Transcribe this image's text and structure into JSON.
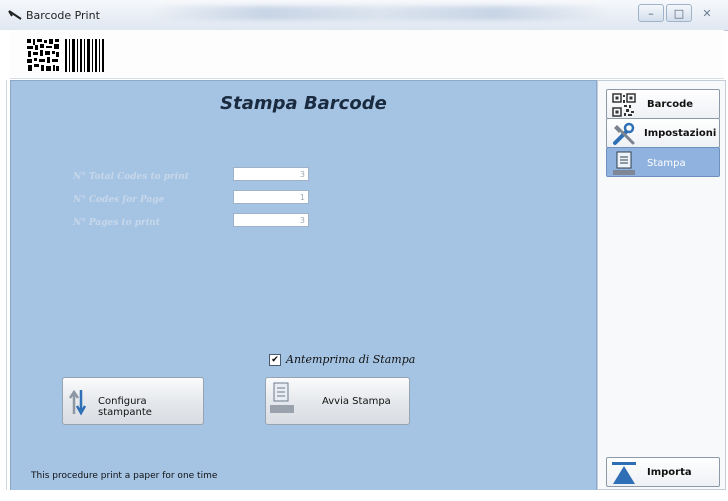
{
  "window": {
    "title": "Barcode Print",
    "controls": [
      "–",
      "□",
      "✕"
    ]
  },
  "main": {
    "title": "Stampa Barcode",
    "fields": [
      {
        "label": "N° Total Codes to print",
        "value": "3"
      },
      {
        "label": "N° Codes for Page",
        "value": "1"
      },
      {
        "label": "N° Pages to print",
        "value": "3"
      }
    ],
    "preview_checkbox": {
      "label": "Antemprima di Stampa",
      "checked": true
    },
    "buttons": {
      "configure_printer": "Configura stampante",
      "start_print": "Avvia Stampa"
    },
    "footer_note": "This procedure print a paper for one time"
  },
  "sidebar": {
    "items": [
      {
        "label": "Barcode",
        "icon": "qr-code-icon",
        "active": false
      },
      {
        "label": "Impostazioni",
        "icon": "tools-icon",
        "active": false
      },
      {
        "label": "Stampa",
        "icon": "document-icon",
        "active": true
      }
    ],
    "import_button": {
      "label": "Importa",
      "icon": "import-arrow-icon"
    }
  },
  "colors": {
    "main_panel": "#a5c4e4",
    "active_item": "#8fb2df",
    "accent_blue": "#2f6fb5"
  }
}
